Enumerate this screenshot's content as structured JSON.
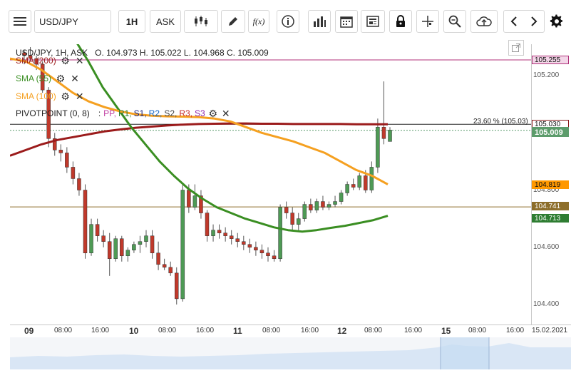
{
  "toolbar": {
    "symbol": "USD/JPY",
    "timeframe": "1H",
    "price_type": "ASK",
    "indicator_label": "f(x)",
    "icons": [
      "menu-icon",
      "candlestick-icon",
      "pencil-icon",
      "function-icon",
      "info-icon",
      "bar-chart-icon",
      "calendar-icon",
      "news-icon",
      "lock-icon",
      "crosshair-icon",
      "zoom-icon",
      "cloud-upload-icon",
      "chevron-left-icon",
      "chevron-right-icon",
      "gear-icon"
    ]
  },
  "legend": {
    "header": "USD/JPY, 1H, ASK",
    "ohlc": "O. 104.973 H. 105.022 L. 104.968 C. 105.009",
    "sma200": "SMA (200)",
    "sma55": "SMA (55)",
    "sma100": "SMA (100)",
    "pivot_label": "PIVOTPOINT (0, 8)",
    "pivot_sep": ":",
    "pivot_items": [
      "PP,",
      "R1,",
      "S1,",
      "R2,",
      "S2,",
      "R3,",
      "S3"
    ],
    "pivot_colors": [
      "#c13fa3",
      "#2e7d32",
      "#1a237e",
      "#1565c0",
      "#424242",
      "#c62828",
      "#8e24aa"
    ]
  },
  "fib_label": "23.60 % (105.03)",
  "price_axis": {
    "ticks": [
      "105.200",
      "104.800",
      "104.600",
      "104.400"
    ],
    "tags": [
      {
        "text": "105.255",
        "bg": "#f3d6e8",
        "border": "#b0327a",
        "color": "#111"
      },
      {
        "text": "105.030",
        "bg": "#ffffff",
        "border": "#8b1a1a",
        "color": "#111"
      },
      {
        "text": "105.009",
        "bg": "#5c9c6b",
        "border": "#5c9c6b",
        "color": "#ffffff"
      },
      {
        "text": "104.819",
        "bg": "#ff9800",
        "border": "#ff9800",
        "color": "#111"
      },
      {
        "text": "104.741",
        "bg": "#8d6e2a",
        "border": "#8d6e2a",
        "color": "#ffffff"
      },
      {
        "text": "104.713",
        "bg": "#2e7d32",
        "border": "#2e7d32",
        "color": "#ffffff"
      }
    ]
  },
  "time_axis": {
    "labels": [
      {
        "text": "09",
        "day": true
      },
      {
        "text": "08:00",
        "day": false
      },
      {
        "text": "16:00",
        "day": false
      },
      {
        "text": "10",
        "day": true
      },
      {
        "text": "08:00",
        "day": false
      },
      {
        "text": "16:00",
        "day": false
      },
      {
        "text": "11",
        "day": true
      },
      {
        "text": "08:00",
        "day": false
      },
      {
        "text": "16:00",
        "day": false
      },
      {
        "text": "12",
        "day": true
      },
      {
        "text": "08:00",
        "day": false
      },
      {
        "text": "16:00",
        "day": false
      },
      {
        "text": "15",
        "day": true
      },
      {
        "text": "08:00",
        "day": false
      },
      {
        "text": "16:00",
        "day": false
      },
      {
        "text": "15.02.2021",
        "day": false
      }
    ]
  },
  "nav_controls": [
    "nav-left-icon",
    "zoom-out-icon",
    "fit-icon",
    "zoom-in-icon",
    "nav-right-icon"
  ],
  "chart_data": {
    "type": "line",
    "title": "USD/JPY, 1H, ASK",
    "y_range": [
      104.33,
      105.31
    ],
    "price_lines": {
      "pivot_r": 105.255,
      "fib_23_6": 105.03,
      "current": 105.009,
      "pivot_pp": 104.741
    },
    "series": [
      {
        "name": "SMA (200)",
        "color": "#9b1b1b",
        "values": [
          104.92,
          104.94,
          104.96,
          104.975,
          104.985,
          104.995,
          105.005,
          105.012,
          105.018,
          105.022,
          105.026,
          105.029,
          105.031,
          105.032,
          105.033,
          105.033,
          105.032,
          105.032,
          105.031,
          105.031,
          105.031,
          105.031,
          105.03,
          105.03,
          105.03
        ]
      },
      {
        "name": "SMA (55)",
        "color": "#3a8e22",
        "values": [
          105.38,
          105.33,
          105.25,
          105.16,
          105.09,
          105.02,
          104.96,
          104.9,
          104.85,
          104.805,
          104.77,
          104.74,
          104.72,
          104.7,
          104.685,
          104.67,
          104.66,
          104.655,
          104.66,
          104.668,
          104.675,
          104.685,
          104.695,
          104.71
        ]
      },
      {
        "name": "SMA (100)",
        "color": "#f5a020",
        "values": [
          105.26,
          105.25,
          105.22,
          105.18,
          105.14,
          105.11,
          105.09,
          105.075,
          105.065,
          105.06,
          105.058,
          105.057,
          105.055,
          105.05,
          105.04,
          105.02,
          105,
          104.985,
          104.97,
          104.95,
          104.93,
          104.9,
          104.87,
          104.85,
          104.82
        ]
      }
    ],
    "candles": [
      [
        105.28,
        105.29,
        105.24,
        105.27
      ],
      [
        105.27,
        105.3,
        105.25,
        105.26
      ],
      [
        105.26,
        105.27,
        105.22,
        105.24
      ],
      [
        105.24,
        105.25,
        105.14,
        105.15
      ],
      [
        105.15,
        105.16,
        104.95,
        104.98
      ],
      [
        104.98,
        105.0,
        104.92,
        104.94
      ],
      [
        104.94,
        104.96,
        104.9,
        104.93
      ],
      [
        104.93,
        104.95,
        104.86,
        104.88
      ],
      [
        104.88,
        104.9,
        104.82,
        104.84
      ],
      [
        104.84,
        104.86,
        104.78,
        104.8
      ],
      [
        104.8,
        104.82,
        104.56,
        104.58
      ],
      [
        104.58,
        104.7,
        104.57,
        104.68
      ],
      [
        104.68,
        104.7,
        104.62,
        104.64
      ],
      [
        104.64,
        104.66,
        104.6,
        104.62
      ],
      [
        104.62,
        104.65,
        104.5,
        104.56
      ],
      [
        104.56,
        104.64,
        104.55,
        104.63
      ],
      [
        104.63,
        104.64,
        104.55,
        104.57
      ],
      [
        104.57,
        104.6,
        104.55,
        104.59
      ],
      [
        104.59,
        104.62,
        104.58,
        104.61
      ],
      [
        104.61,
        104.64,
        104.58,
        104.62
      ],
      [
        104.62,
        104.66,
        104.6,
        104.64
      ],
      [
        104.64,
        104.66,
        104.56,
        104.58
      ],
      [
        104.58,
        104.62,
        104.52,
        104.54
      ],
      [
        104.54,
        104.56,
        104.52,
        104.53
      ],
      [
        104.53,
        104.55,
        104.5,
        104.51
      ],
      [
        104.51,
        104.53,
        104.4,
        104.42
      ],
      [
        104.42,
        104.82,
        104.41,
        104.8
      ],
      [
        104.8,
        104.82,
        104.72,
        104.74
      ],
      [
        104.74,
        104.82,
        104.73,
        104.78
      ],
      [
        104.78,
        104.8,
        104.7,
        104.72
      ],
      [
        104.72,
        104.73,
        104.62,
        104.64
      ],
      [
        104.64,
        104.68,
        104.62,
        104.66
      ],
      [
        104.66,
        104.68,
        104.63,
        104.65
      ],
      [
        104.65,
        104.67,
        104.62,
        104.64
      ],
      [
        104.64,
        104.66,
        104.61,
        104.63
      ],
      [
        104.63,
        104.65,
        104.6,
        104.62
      ],
      [
        104.62,
        104.64,
        104.59,
        104.61
      ],
      [
        104.61,
        104.63,
        104.58,
        104.6
      ],
      [
        104.6,
        104.62,
        104.57,
        104.59
      ],
      [
        104.59,
        104.61,
        104.56,
        104.58
      ],
      [
        104.58,
        104.6,
        104.55,
        104.57
      ],
      [
        104.57,
        104.59,
        104.55,
        104.56
      ],
      [
        104.56,
        104.75,
        104.55,
        104.74
      ],
      [
        104.74,
        104.76,
        104.7,
        104.72
      ],
      [
        104.72,
        104.74,
        104.66,
        104.68
      ],
      [
        104.68,
        104.72,
        104.66,
        104.7
      ],
      [
        104.7,
        104.76,
        104.69,
        104.75
      ],
      [
        104.75,
        104.77,
        104.72,
        104.73
      ],
      [
        104.73,
        104.77,
        104.72,
        104.76
      ],
      [
        104.76,
        104.78,
        104.73,
        104.74
      ],
      [
        104.74,
        104.76,
        104.73,
        104.75
      ],
      [
        104.75,
        104.78,
        104.74,
        104.76
      ],
      [
        104.76,
        104.8,
        104.75,
        104.79
      ],
      [
        104.79,
        104.83,
        104.78,
        104.82
      ],
      [
        104.82,
        104.84,
        104.8,
        104.81
      ],
      [
        104.81,
        104.86,
        104.8,
        104.85
      ],
      [
        104.85,
        104.87,
        104.79,
        104.8
      ],
      [
        104.8,
        104.9,
        104.79,
        104.88
      ],
      [
        104.88,
        105.05,
        104.86,
        105.02
      ],
      [
        105.02,
        105.18,
        104.96,
        104.98
      ],
      [
        104.97,
        105.02,
        104.97,
        105.01
      ]
    ]
  }
}
